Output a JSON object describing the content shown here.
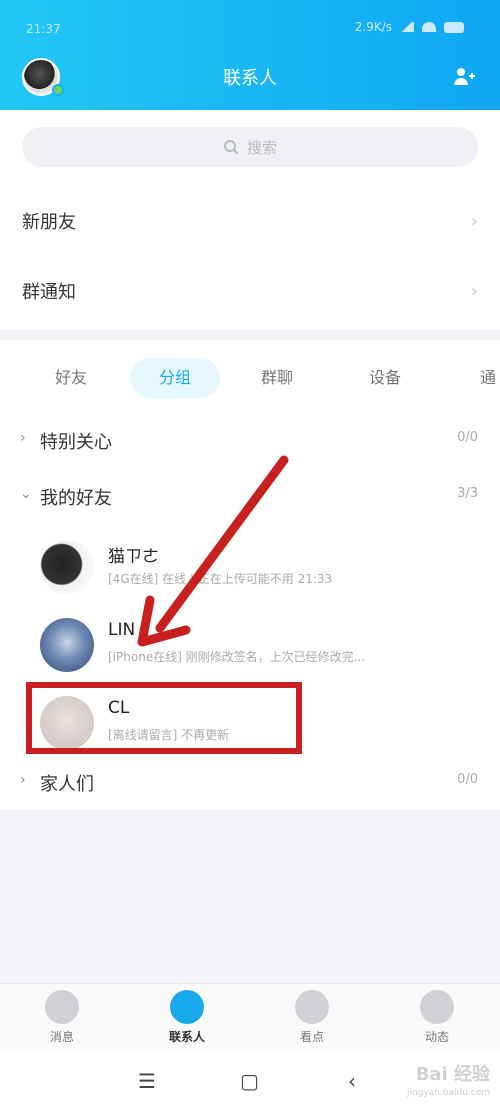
{
  "statusbar": {
    "time": "21:37",
    "net": "2.9K/s"
  },
  "header": {
    "title": "联系人"
  },
  "search": {
    "placeholder": "搜索"
  },
  "nav": [
    {
      "label": "新朋友"
    },
    {
      "label": "群通知"
    }
  ],
  "tabs": [
    {
      "label": "好友"
    },
    {
      "label": "分组"
    },
    {
      "label": "群聊"
    },
    {
      "label": "设备"
    },
    {
      "label": "通"
    }
  ],
  "groups": {
    "special": {
      "name": "特别关心",
      "count": "0/0"
    },
    "friends": {
      "name": "我的好友",
      "count": "3/3"
    },
    "family": {
      "name": "家人们",
      "count": "0/0"
    }
  },
  "friends": [
    {
      "name": "猫ㄗㄜ",
      "status": "[4G在线] 在线 | 正在上传可能不用 21:33"
    },
    {
      "name": "LIN",
      "status": "[iPhone在线] 刚刚修改签名，上次已经修改完..."
    },
    {
      "name": "CL",
      "status": "[离线请留言] 不再更新"
    }
  ],
  "tabbar": [
    {
      "label": "消息"
    },
    {
      "label": "联系人"
    },
    {
      "label": "看点"
    },
    {
      "label": "动态"
    }
  ],
  "watermark": {
    "text": "Bai 经验",
    "sub": "jingyan.baidu.com"
  },
  "colors": {
    "accent": "#17a9ec",
    "highlight": "#c8201e"
  }
}
